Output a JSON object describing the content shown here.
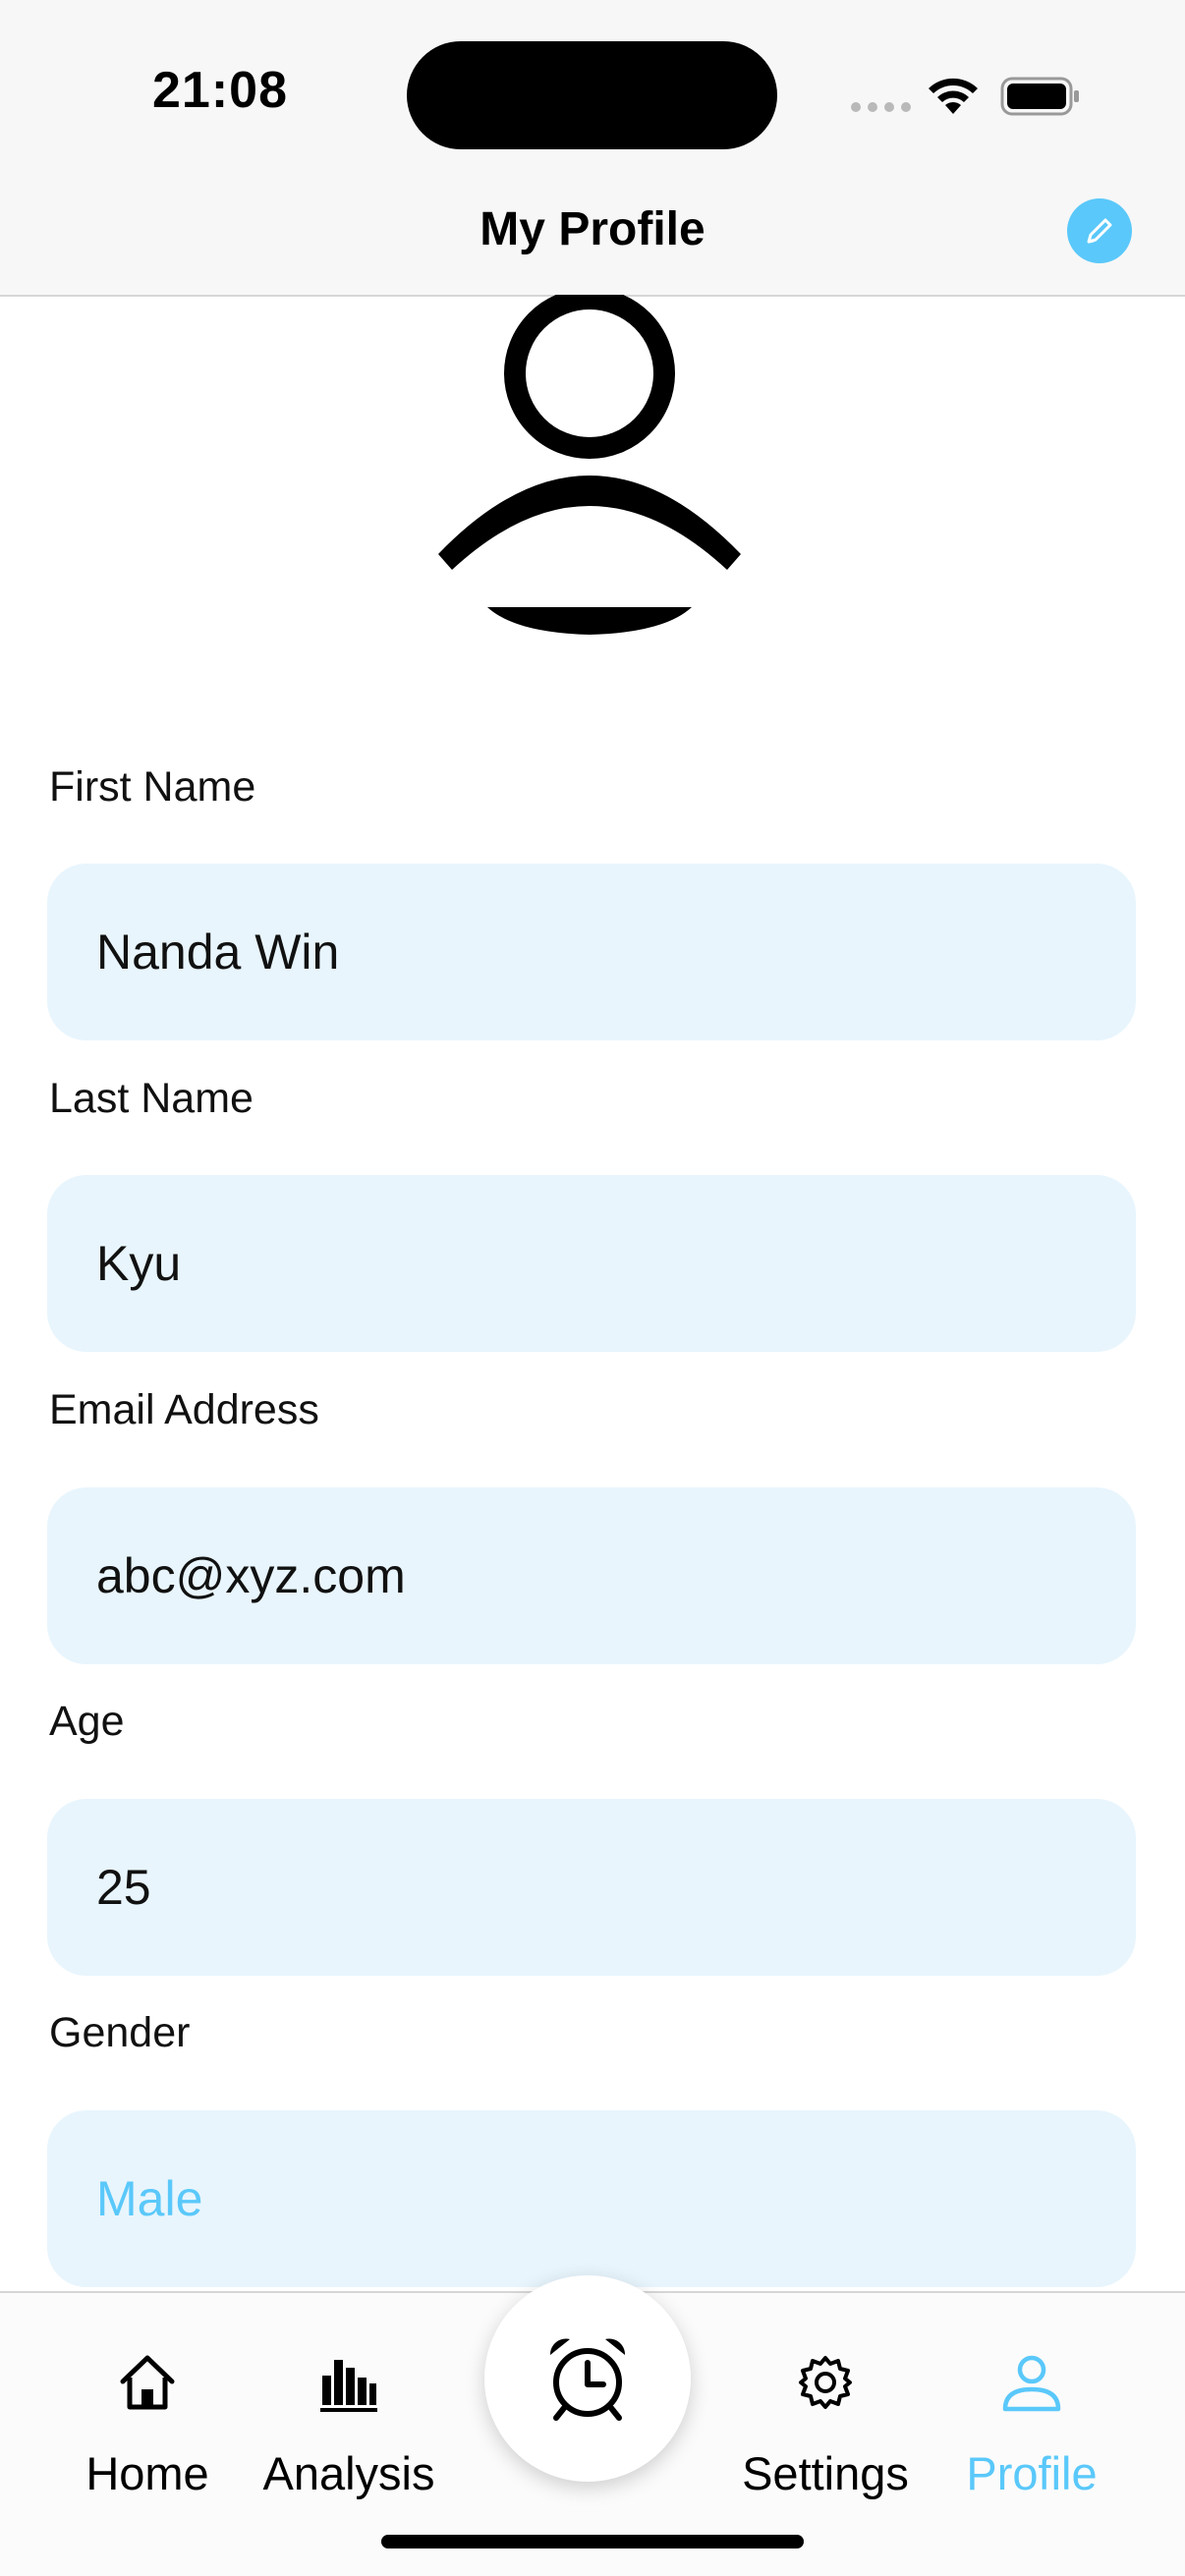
{
  "status_bar": {
    "time": "21:08"
  },
  "nav": {
    "title": "My Profile",
    "edit_icon": "pencil-icon"
  },
  "avatar": {
    "icon": "person-icon"
  },
  "form": {
    "fields": [
      {
        "label": "First Name",
        "value": "Nanda Win"
      },
      {
        "label": "Last Name",
        "value": "Kyu"
      },
      {
        "label": "Email Address",
        "value": "abc@xyz.com"
      },
      {
        "label": "Age",
        "value": "25"
      },
      {
        "label": "Gender",
        "value": "Male"
      }
    ]
  },
  "tabbar": {
    "items": [
      {
        "label": "Home",
        "icon": "house-icon"
      },
      {
        "label": "Analysis",
        "icon": "bar-chart-icon"
      },
      {
        "label": "",
        "icon": "alarm-clock-icon"
      },
      {
        "label": "Settings",
        "icon": "gear-icon"
      },
      {
        "label": "Profile",
        "icon": "person-icon",
        "active": true
      }
    ]
  },
  "colors": {
    "accent": "#5ac8fa",
    "field_bg": "#e8f5fd",
    "nav_bg": "#f7f7f7"
  }
}
